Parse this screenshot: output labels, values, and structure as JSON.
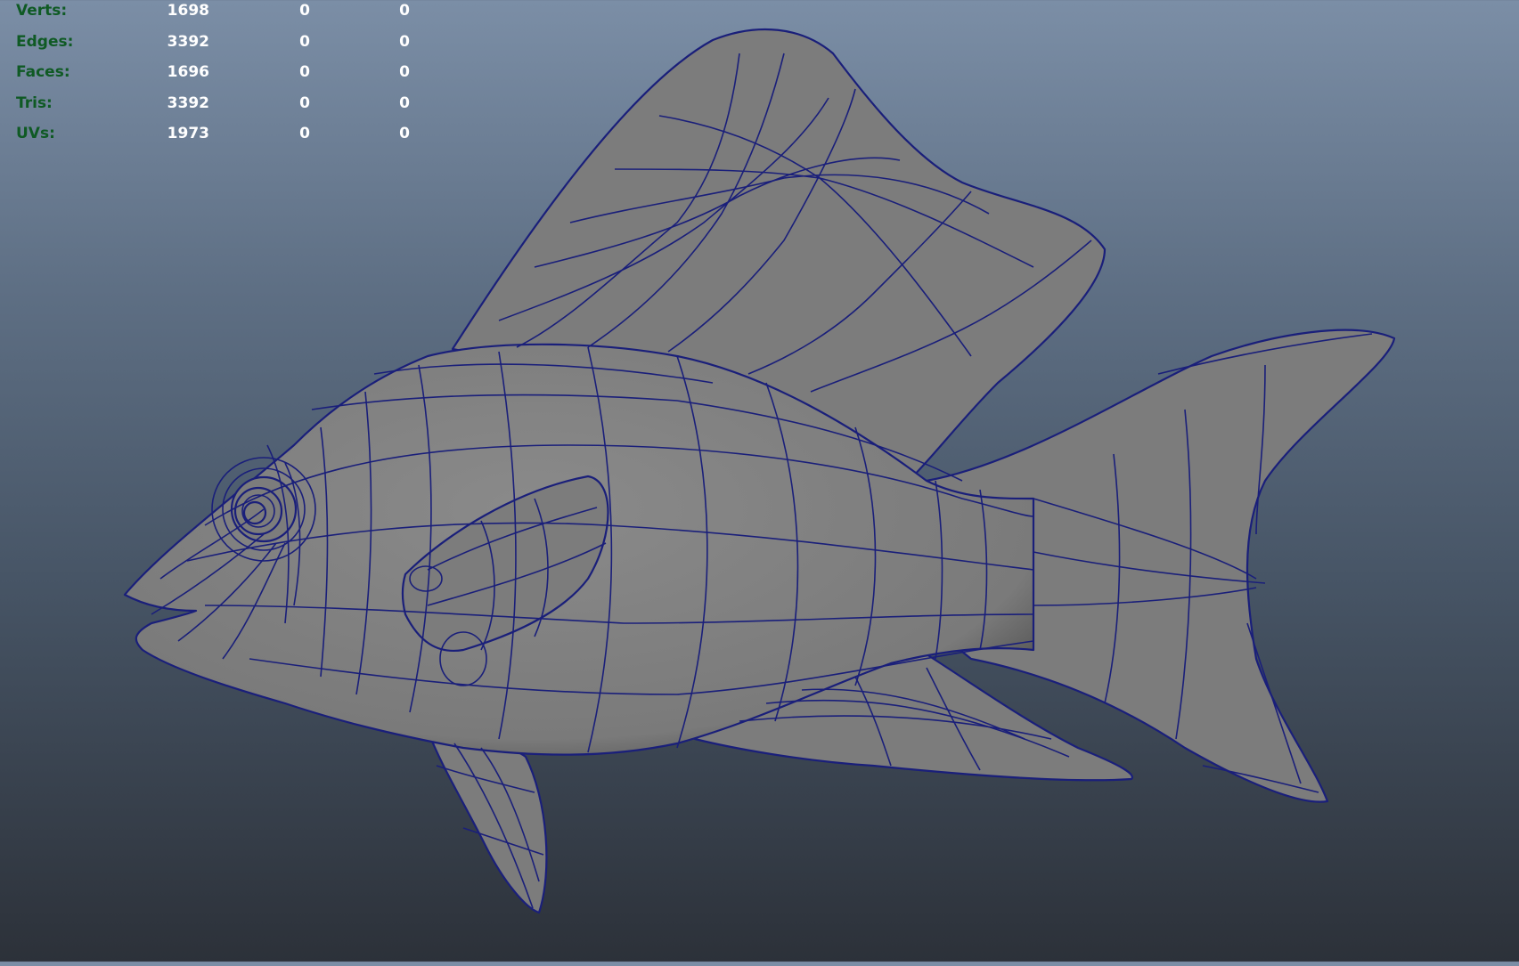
{
  "poly_count_hud": {
    "rows": [
      {
        "label": "Verts:",
        "values": [
          "1698",
          "0",
          "0"
        ]
      },
      {
        "label": "Edges:",
        "values": [
          "3392",
          "0",
          "0"
        ]
      },
      {
        "label": "Faces:",
        "values": [
          "1696",
          "0",
          "0"
        ]
      },
      {
        "label": "Tris:",
        "values": [
          "3392",
          "0",
          "0"
        ]
      },
      {
        "label": "UVs:",
        "values": [
          "1973",
          "0",
          "0"
        ]
      }
    ]
  },
  "viewport": {
    "background_top": "#7b8ea6",
    "background_bottom": "#2c3139",
    "mesh_fill": "#7a7a7a",
    "wire_color": "#1a1f7a",
    "model": "fish-mesh"
  }
}
